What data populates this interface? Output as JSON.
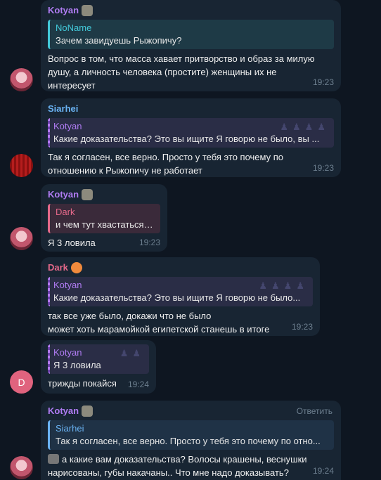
{
  "messages": [
    {
      "sender": "Kotyan",
      "sender_color": "#b07cf3",
      "avatar": "kotyan-avatar",
      "reply": {
        "name": "NoName",
        "text": "Зачем завидуешь Рыжопичу?"
      },
      "lines": [
        "Вопрос в том, что масса хавает притворство и образ за милую",
        "душу, а личность человека (простите) женщины их не",
        "интересует"
      ],
      "time": "19:23"
    },
    {
      "sender": "Siarhei",
      "sender_color": "#6ab3f3",
      "avatar": "siarhei-avatar",
      "reply": {
        "name": "Kotyan",
        "text": "Какие доказательства? Это вы ищите  Я говорю не было, вы ..."
      },
      "lines": [
        "Так я согласен, все верно. Просто у тебя это почему по",
        "отношению к Рыжопичу не работает"
      ],
      "time": "19:23"
    },
    {
      "sender": "Kotyan",
      "sender_color": "#b07cf3",
      "avatar": "kotyan-avatar",
      "reply": {
        "name": "Dark",
        "text": "и чем тут хвастаться?..."
      },
      "lines": [
        "Я 3 ловила"
      ],
      "time": "19:23"
    },
    {
      "sender": "Dark",
      "sender_color": "#e5698a",
      "avatar": "none",
      "reply": {
        "name": "Kotyan",
        "text": "Какие доказательства? Это вы ищите  Я говорю не было..."
      },
      "lines": [
        "так все уже было, докажи что не было",
        "может хоть марамойкой египетской станешь в итоге"
      ],
      "time": "19:23"
    },
    {
      "sender": "",
      "avatar_letter": "D",
      "reply": {
        "name": "Kotyan",
        "text": "Я 3 ловила"
      },
      "lines": [
        "трижды покайся"
      ],
      "time": "19:24"
    },
    {
      "sender": "Kotyan",
      "sender_color": "#b07cf3",
      "avatar": "kotyan-avatar",
      "reply_action": "Ответить",
      "reply": {
        "name": "Siarhei",
        "text": "Так я согласен, все верно. Просто у тебя это почему по отно..."
      },
      "lines": [
        "а какие вам доказательства? Волосы крашены, веснушки",
        "нарисованы, губы накачаны.. Что мне надо доказывать?"
      ],
      "time": "19:24"
    }
  ]
}
